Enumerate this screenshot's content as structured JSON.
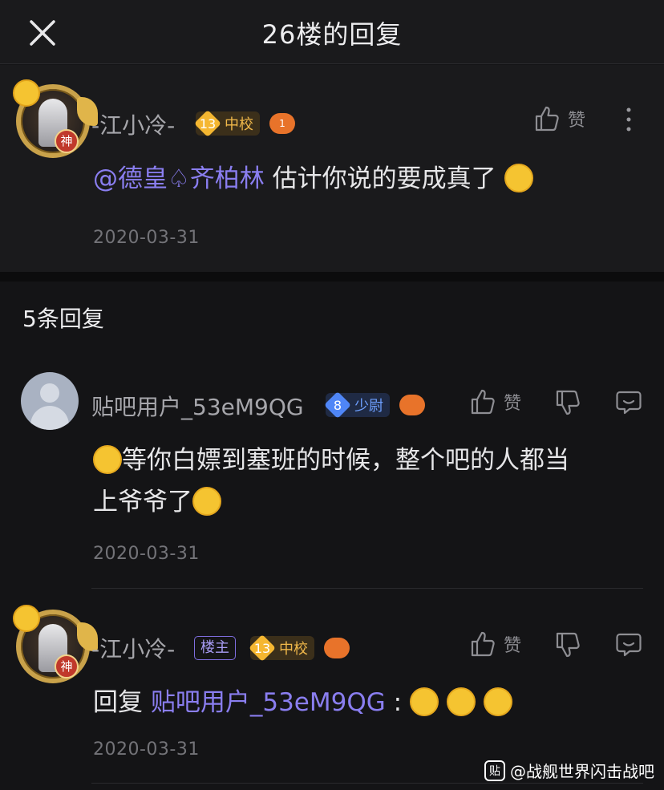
{
  "header": {
    "title": "26楼的回复"
  },
  "main_post": {
    "username": "-江小冷-",
    "level": "13",
    "rank": "中校",
    "game_badge": "1",
    "mention": "@德皇♤齐柏林",
    "text": " 估计你说的要成真了",
    "date": "2020-03-31",
    "like_label": "赞"
  },
  "replies_section": {
    "title": "5条回复"
  },
  "replies": [
    {
      "username": "贴吧用户_53eM9QG",
      "level": "8",
      "rank": "少尉",
      "line1": "等你白嫖到塞班的时候，整个吧的人都当",
      "line2": "上爷爷了",
      "date": "2020-03-31",
      "like_label": "赞"
    },
    {
      "username": "-江小冷-",
      "tag": "楼主",
      "level": "13",
      "rank": "中校",
      "reply_prefix": "回复 ",
      "reply_to": "贴吧用户_53eM9QG",
      "reply_colon": " :",
      "date": "2020-03-31",
      "like_label": "赞"
    }
  ],
  "watermark": {
    "badge": "贴",
    "text": "@战舰世界闪击战吧"
  },
  "colors": {
    "background": "#141416",
    "mention": "#8a7ef0",
    "gold_badge": "#f5b731",
    "blue_badge": "#4f86f7"
  }
}
